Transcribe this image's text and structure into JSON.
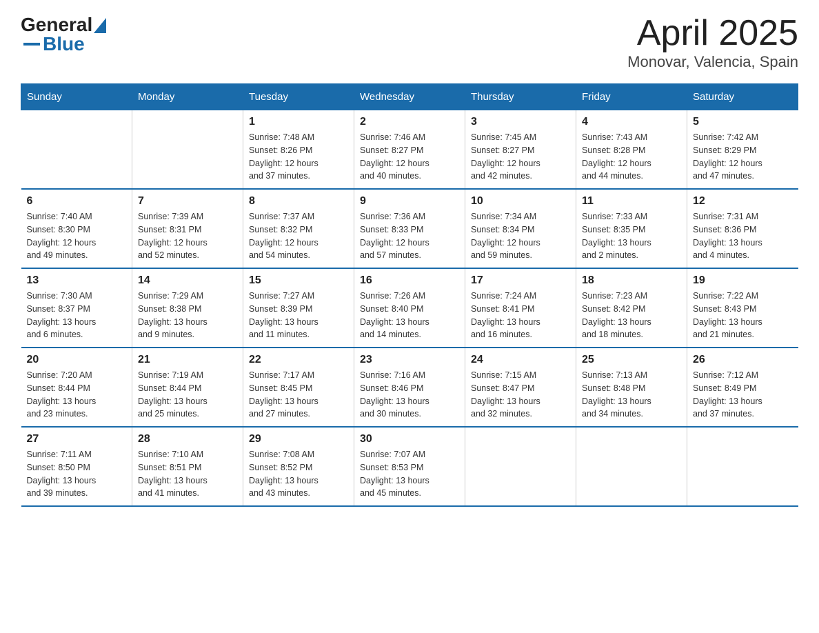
{
  "header": {
    "logo": {
      "text_general": "General",
      "text_blue": "Blue"
    },
    "title": "April 2025",
    "subtitle": "Monovar, Valencia, Spain"
  },
  "days_of_week": [
    "Sunday",
    "Monday",
    "Tuesday",
    "Wednesday",
    "Thursday",
    "Friday",
    "Saturday"
  ],
  "weeks": [
    [
      {
        "day": "",
        "info": ""
      },
      {
        "day": "",
        "info": ""
      },
      {
        "day": "1",
        "info": "Sunrise: 7:48 AM\nSunset: 8:26 PM\nDaylight: 12 hours\nand 37 minutes."
      },
      {
        "day": "2",
        "info": "Sunrise: 7:46 AM\nSunset: 8:27 PM\nDaylight: 12 hours\nand 40 minutes."
      },
      {
        "day": "3",
        "info": "Sunrise: 7:45 AM\nSunset: 8:27 PM\nDaylight: 12 hours\nand 42 minutes."
      },
      {
        "day": "4",
        "info": "Sunrise: 7:43 AM\nSunset: 8:28 PM\nDaylight: 12 hours\nand 44 minutes."
      },
      {
        "day": "5",
        "info": "Sunrise: 7:42 AM\nSunset: 8:29 PM\nDaylight: 12 hours\nand 47 minutes."
      }
    ],
    [
      {
        "day": "6",
        "info": "Sunrise: 7:40 AM\nSunset: 8:30 PM\nDaylight: 12 hours\nand 49 minutes."
      },
      {
        "day": "7",
        "info": "Sunrise: 7:39 AM\nSunset: 8:31 PM\nDaylight: 12 hours\nand 52 minutes."
      },
      {
        "day": "8",
        "info": "Sunrise: 7:37 AM\nSunset: 8:32 PM\nDaylight: 12 hours\nand 54 minutes."
      },
      {
        "day": "9",
        "info": "Sunrise: 7:36 AM\nSunset: 8:33 PM\nDaylight: 12 hours\nand 57 minutes."
      },
      {
        "day": "10",
        "info": "Sunrise: 7:34 AM\nSunset: 8:34 PM\nDaylight: 12 hours\nand 59 minutes."
      },
      {
        "day": "11",
        "info": "Sunrise: 7:33 AM\nSunset: 8:35 PM\nDaylight: 13 hours\nand 2 minutes."
      },
      {
        "day": "12",
        "info": "Sunrise: 7:31 AM\nSunset: 8:36 PM\nDaylight: 13 hours\nand 4 minutes."
      }
    ],
    [
      {
        "day": "13",
        "info": "Sunrise: 7:30 AM\nSunset: 8:37 PM\nDaylight: 13 hours\nand 6 minutes."
      },
      {
        "day": "14",
        "info": "Sunrise: 7:29 AM\nSunset: 8:38 PM\nDaylight: 13 hours\nand 9 minutes."
      },
      {
        "day": "15",
        "info": "Sunrise: 7:27 AM\nSunset: 8:39 PM\nDaylight: 13 hours\nand 11 minutes."
      },
      {
        "day": "16",
        "info": "Sunrise: 7:26 AM\nSunset: 8:40 PM\nDaylight: 13 hours\nand 14 minutes."
      },
      {
        "day": "17",
        "info": "Sunrise: 7:24 AM\nSunset: 8:41 PM\nDaylight: 13 hours\nand 16 minutes."
      },
      {
        "day": "18",
        "info": "Sunrise: 7:23 AM\nSunset: 8:42 PM\nDaylight: 13 hours\nand 18 minutes."
      },
      {
        "day": "19",
        "info": "Sunrise: 7:22 AM\nSunset: 8:43 PM\nDaylight: 13 hours\nand 21 minutes."
      }
    ],
    [
      {
        "day": "20",
        "info": "Sunrise: 7:20 AM\nSunset: 8:44 PM\nDaylight: 13 hours\nand 23 minutes."
      },
      {
        "day": "21",
        "info": "Sunrise: 7:19 AM\nSunset: 8:44 PM\nDaylight: 13 hours\nand 25 minutes."
      },
      {
        "day": "22",
        "info": "Sunrise: 7:17 AM\nSunset: 8:45 PM\nDaylight: 13 hours\nand 27 minutes."
      },
      {
        "day": "23",
        "info": "Sunrise: 7:16 AM\nSunset: 8:46 PM\nDaylight: 13 hours\nand 30 minutes."
      },
      {
        "day": "24",
        "info": "Sunrise: 7:15 AM\nSunset: 8:47 PM\nDaylight: 13 hours\nand 32 minutes."
      },
      {
        "day": "25",
        "info": "Sunrise: 7:13 AM\nSunset: 8:48 PM\nDaylight: 13 hours\nand 34 minutes."
      },
      {
        "day": "26",
        "info": "Sunrise: 7:12 AM\nSunset: 8:49 PM\nDaylight: 13 hours\nand 37 minutes."
      }
    ],
    [
      {
        "day": "27",
        "info": "Sunrise: 7:11 AM\nSunset: 8:50 PM\nDaylight: 13 hours\nand 39 minutes."
      },
      {
        "day": "28",
        "info": "Sunrise: 7:10 AM\nSunset: 8:51 PM\nDaylight: 13 hours\nand 41 minutes."
      },
      {
        "day": "29",
        "info": "Sunrise: 7:08 AM\nSunset: 8:52 PM\nDaylight: 13 hours\nand 43 minutes."
      },
      {
        "day": "30",
        "info": "Sunrise: 7:07 AM\nSunset: 8:53 PM\nDaylight: 13 hours\nand 45 minutes."
      },
      {
        "day": "",
        "info": ""
      },
      {
        "day": "",
        "info": ""
      },
      {
        "day": "",
        "info": ""
      }
    ]
  ]
}
